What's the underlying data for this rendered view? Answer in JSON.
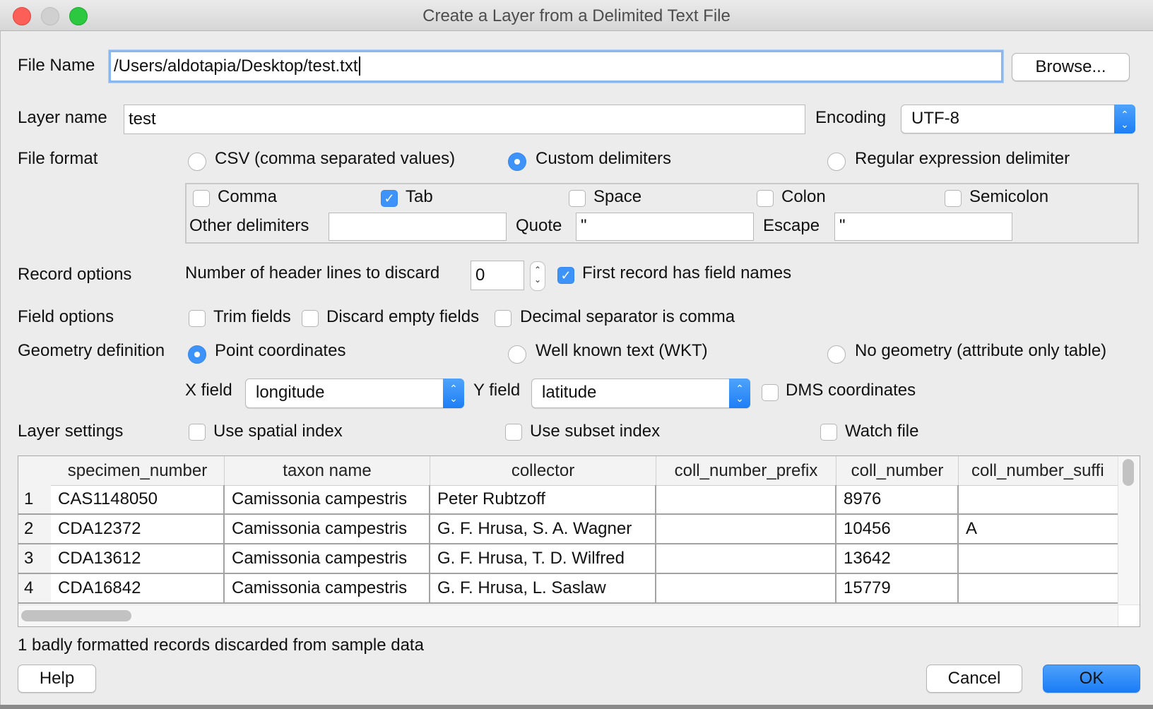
{
  "window": {
    "title": "Create a Layer from a Delimited Text File",
    "traffic_lights": {
      "close": "#fc5f57",
      "minimize": "#d0d0d0",
      "zoom": "#2cc840"
    }
  },
  "file": {
    "label": "File Name",
    "value": "/Users/aldotapia/Desktop/test.txt",
    "browse_label": "Browse..."
  },
  "layer": {
    "label": "Layer name",
    "value": "test",
    "encoding_label": "Encoding",
    "encoding_value": "UTF-8"
  },
  "file_format": {
    "label": "File format",
    "options": [
      {
        "label": "CSV (comma separated values)",
        "selected": false
      },
      {
        "label": "Custom delimiters",
        "selected": true
      },
      {
        "label": "Regular expression delimiter",
        "selected": false
      }
    ],
    "delimiters": [
      {
        "label": "Comma",
        "checked": false
      },
      {
        "label": "Tab",
        "checked": true
      },
      {
        "label": "Space",
        "checked": false
      },
      {
        "label": "Colon",
        "checked": false
      },
      {
        "label": "Semicolon",
        "checked": false
      }
    ],
    "other_label": "Other delimiters",
    "other_value": "",
    "quote_label": "Quote",
    "quote_value": "\"",
    "escape_label": "Escape",
    "escape_value": "\""
  },
  "record_options": {
    "label": "Record options",
    "header_lines_label": "Number of header lines to discard",
    "header_lines_value": "0",
    "first_record_label": "First record has field names",
    "first_record_checked": true
  },
  "field_options": {
    "label": "Field options",
    "items": [
      {
        "label": "Trim fields",
        "checked": false
      },
      {
        "label": "Discard empty fields",
        "checked": false
      },
      {
        "label": "Decimal separator is comma",
        "checked": false
      }
    ]
  },
  "geometry": {
    "label": "Geometry definition",
    "options": [
      {
        "label": "Point coordinates",
        "selected": true
      },
      {
        "label": "Well known text (WKT)",
        "selected": false
      },
      {
        "label": "No geometry (attribute only table)",
        "selected": false
      }
    ],
    "x_label": "X field",
    "x_value": "longitude",
    "y_label": "Y field",
    "y_value": "latitude",
    "dms_label": "DMS coordinates",
    "dms_checked": false
  },
  "layer_settings": {
    "label": "Layer settings",
    "items": [
      {
        "label": "Use spatial index",
        "checked": false
      },
      {
        "label": "Use subset index",
        "checked": false
      },
      {
        "label": "Watch file",
        "checked": false
      }
    ]
  },
  "table": {
    "columns": [
      "specimen_number",
      "taxon name",
      "collector",
      "coll_number_prefix",
      "coll_number",
      "coll_number_suffi"
    ],
    "rows": [
      {
        "n": "1",
        "cells": [
          "CAS1148050",
          "Camissonia campestris",
          "Peter Rubtzoff",
          "",
          "8976",
          ""
        ]
      },
      {
        "n": "2",
        "cells": [
          "CDA12372",
          "Camissonia campestris",
          "G. F. Hrusa, S. A. Wagner",
          "",
          "10456",
          "A"
        ]
      },
      {
        "n": "3",
        "cells": [
          "CDA13612",
          "Camissonia campestris",
          "G. F. Hrusa, T. D. Wilfred",
          "",
          "13642",
          ""
        ]
      },
      {
        "n": "4",
        "cells": [
          "CDA16842",
          "Camissonia campestris",
          "G. F. Hrusa, L. Saslaw",
          "",
          "15779",
          ""
        ]
      }
    ]
  },
  "status": "1 badly formatted records discarded from sample data",
  "buttons": {
    "help": "Help",
    "cancel": "Cancel",
    "ok": "OK"
  }
}
